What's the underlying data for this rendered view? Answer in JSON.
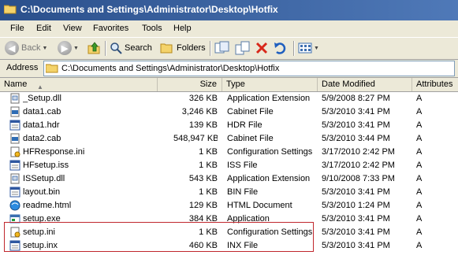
{
  "window": {
    "title": "C:\\Documents and Settings\\Administrator\\Desktop\\Hotfix"
  },
  "menu": {
    "items": [
      "File",
      "Edit",
      "View",
      "Favorites",
      "Tools",
      "Help"
    ]
  },
  "toolbar": {
    "back_label": "Back",
    "search_label": "Search",
    "folders_label": "Folders"
  },
  "address": {
    "label": "Address",
    "value": "C:\\Documents and Settings\\Administrator\\Desktop\\Hotfix"
  },
  "columns": {
    "name": "Name",
    "size": "Size",
    "type": "Type",
    "date": "Date Modified",
    "attributes": "Attributes"
  },
  "files": [
    {
      "name": "_Setup.dll",
      "size": "326 KB",
      "type": "Application Extension",
      "date": "5/9/2008 8:27 PM",
      "attr": "A",
      "icon": "dll-icon"
    },
    {
      "name": "data1.cab",
      "size": "3,246 KB",
      "type": "Cabinet File",
      "date": "5/3/2010 3:41 PM",
      "attr": "A",
      "icon": "cab-icon"
    },
    {
      "name": "data1.hdr",
      "size": "139 KB",
      "type": "HDR File",
      "date": "5/3/2010 3:41 PM",
      "attr": "A",
      "icon": "generic-file-icon"
    },
    {
      "name": "data2.cab",
      "size": "548,947 KB",
      "type": "Cabinet File",
      "date": "5/3/2010 3:44 PM",
      "attr": "A",
      "icon": "cab-icon"
    },
    {
      "name": "HFResponse.ini",
      "size": "1 KB",
      "type": "Configuration Settings",
      "date": "3/17/2010 2:42 PM",
      "attr": "A",
      "icon": "ini-icon"
    },
    {
      "name": "HFsetup.iss",
      "size": "1 KB",
      "type": "ISS File",
      "date": "3/17/2010 2:42 PM",
      "attr": "A",
      "icon": "generic-file-icon"
    },
    {
      "name": "ISSetup.dll",
      "size": "543 KB",
      "type": "Application Extension",
      "date": "9/10/2008 7:33 PM",
      "attr": "A",
      "icon": "dll-icon"
    },
    {
      "name": "layout.bin",
      "size": "1 KB",
      "type": "BIN File",
      "date": "5/3/2010 3:41 PM",
      "attr": "A",
      "icon": "generic-file-icon"
    },
    {
      "name": "readme.html",
      "size": "129 KB",
      "type": "HTML Document",
      "date": "5/3/2010 1:24 PM",
      "attr": "A",
      "icon": "html-icon"
    },
    {
      "name": "setup.exe",
      "size": "384 KB",
      "type": "Application",
      "date": "5/3/2010 3:41 PM",
      "attr": "A",
      "icon": "exe-icon"
    },
    {
      "name": "setup.ini",
      "size": "1 KB",
      "type": "Configuration Settings",
      "date": "5/3/2010 3:41 PM",
      "attr": "A",
      "icon": "ini-icon"
    },
    {
      "name": "setup.inx",
      "size": "460 KB",
      "type": "INX File",
      "date": "5/3/2010 3:41 PM",
      "attr": "A",
      "icon": "generic-file-icon"
    }
  ],
  "colors": {
    "title_bar": "#2a4f8b",
    "highlight_box": "#c0272d"
  }
}
